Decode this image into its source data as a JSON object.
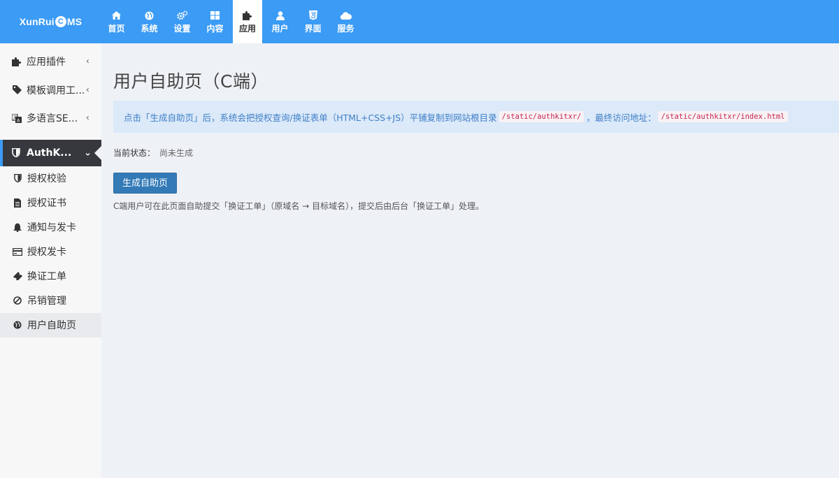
{
  "brand": {
    "logo_left": "XunRui",
    "logo_mark": "C",
    "logo_right": "MS"
  },
  "nav": [
    {
      "label": "首页",
      "icon": "home-icon"
    },
    {
      "label": "系统",
      "icon": "globe-icon"
    },
    {
      "label": "设置",
      "icon": "cogs-icon"
    },
    {
      "label": "内容",
      "icon": "grid-icon"
    },
    {
      "label": "应用",
      "icon": "puzzle-icon",
      "active": true
    },
    {
      "label": "用户",
      "icon": "user-icon"
    },
    {
      "label": "界面",
      "icon": "html5-icon"
    },
    {
      "label": "服务",
      "icon": "cloud-icon"
    }
  ],
  "sidebar": {
    "groups": [
      {
        "label": "应用插件",
        "icon": "puzzle-icon"
      },
      {
        "label": "模板调用工...",
        "icon": "tag-icon"
      },
      {
        "label": "多语言SE...",
        "icon": "translate-icon"
      }
    ],
    "active_group": {
      "label": "AuthK...",
      "icon": "shield-icon"
    },
    "items": [
      {
        "label": "授权校验",
        "icon": "shield-icon"
      },
      {
        "label": "授权证书",
        "icon": "file-icon"
      },
      {
        "label": "通知与发卡",
        "icon": "bell-icon"
      },
      {
        "label": "授权发卡",
        "icon": "card-icon"
      },
      {
        "label": "换证工单",
        "icon": "ticket-icon"
      },
      {
        "label": "吊销管理",
        "icon": "ban-icon"
      },
      {
        "label": "用户自助页",
        "icon": "globe-icon",
        "current": true
      }
    ]
  },
  "main": {
    "title": "用户自助页（C端）",
    "note": {
      "text1": "点击「生成自助页」后，系统会把授权查询/换证表单（HTML+CSS+JS）平铺复制到网站根目录",
      "code1": "/static/authkitxr/",
      "text2": "，最终访问地址：",
      "code2": "/static/authkitxr/index.html"
    },
    "status_label": "当前状态：",
    "status_value": "尚未生成",
    "generate_button": "生成自助页",
    "hint": "C端用户可在此页面自助提交「换证工单」（原域名 → 目标域名），提交后由后台「换证工单」处理。"
  },
  "colors": {
    "topbar": "#3b9bf5",
    "sidebar_active": "#36383d",
    "button": "#337ab7",
    "note_bg": "#dbe9f9",
    "note_text": "#3f7fc7"
  }
}
